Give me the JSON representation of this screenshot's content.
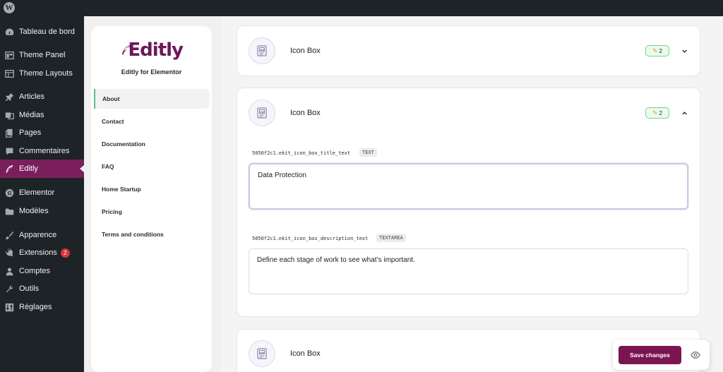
{
  "adminbar": {
    "logo_icon": "wordpress-icon"
  },
  "adminmenu": {
    "items": [
      {
        "label": "Tableau de bord",
        "icon": "dashboard-icon"
      },
      {
        "label": "Theme Panel",
        "icon": "theme-panel-icon"
      },
      {
        "label": "Theme Layouts",
        "icon": "theme-layouts-icon"
      },
      {
        "label": "Articles",
        "icon": "pin-icon"
      },
      {
        "label": "Médias",
        "icon": "media-icon"
      },
      {
        "label": "Pages",
        "icon": "pages-icon"
      },
      {
        "label": "Commentaires",
        "icon": "comment-icon"
      },
      {
        "label": "Editly",
        "icon": "feather-icon",
        "active": true
      },
      {
        "label": "Elementor",
        "icon": "elementor-icon"
      },
      {
        "label": "Modèles",
        "icon": "folder-icon"
      },
      {
        "label": "Apparence",
        "icon": "brush-icon"
      },
      {
        "label": "Extensions",
        "icon": "plugin-icon",
        "badge": "2"
      },
      {
        "label": "Comptes",
        "icon": "user-icon"
      },
      {
        "label": "Outils",
        "icon": "wrench-icon"
      },
      {
        "label": "Réglages",
        "icon": "settings-icon"
      }
    ]
  },
  "plugin": {
    "logo_text": "Editly",
    "subtitle": "Editly for Elementor",
    "nav": [
      {
        "label": "About",
        "active": true
      },
      {
        "label": "Contact"
      },
      {
        "label": "Documentation"
      },
      {
        "label": "FAQ"
      },
      {
        "label": "Home Startup"
      },
      {
        "label": "Pricing"
      },
      {
        "label": "Terms and conditions"
      }
    ]
  },
  "cards": [
    {
      "title": "Icon Box",
      "count": "2",
      "expanded": false
    },
    {
      "title": "Icon Box",
      "count": "2",
      "expanded": true,
      "fields": [
        {
          "key": "5050f2c1.ekit_icon_box_title_text",
          "type": "TEXT",
          "value": "Data Protection"
        },
        {
          "key": "5050f2c1.ekit_icon_box_description_text",
          "type": "TEXTAREA",
          "value": "Define each stage of work to see what’s important."
        }
      ]
    },
    {
      "title": "Icon Box"
    }
  ],
  "actions": {
    "save_label": "Save changes",
    "preview_icon": "eye-icon"
  },
  "colors": {
    "brand": "#7b1552",
    "menu_active": "#7a1f5c",
    "pill_border": "#7dd08f",
    "admin_bg": "#1d2327"
  }
}
